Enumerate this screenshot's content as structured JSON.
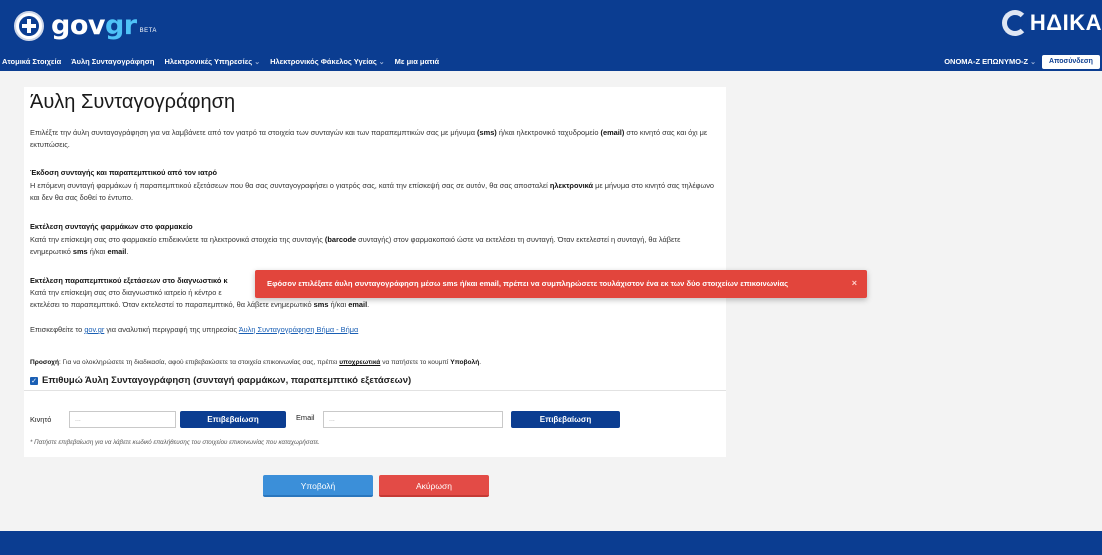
{
  "header": {
    "logo_text_gov": "gov",
    "logo_text_gr": "gr",
    "logo_badge": "BETA",
    "partner_logo": "ΗΔΙΚΑ"
  },
  "nav": {
    "items": [
      {
        "label": "Ατομικά Στοιχεία",
        "dropdown": false
      },
      {
        "label": "Άυλη Συνταγογράφηση",
        "dropdown": false
      },
      {
        "label": "Ηλεκτρονικές Υπηρεσίες",
        "dropdown": true
      },
      {
        "label": "Ηλεκτρονικός Φάκελος Υγείας",
        "dropdown": true
      },
      {
        "label": "Με μια ματιά",
        "dropdown": false
      }
    ],
    "user": "ΟΝΟΜΑ-Ζ ΕΠΩΝΥΜΟ-Ζ",
    "logout": "Αποσύνδεση"
  },
  "page": {
    "title": "Άυλη Συνταγογράφηση",
    "intro_1": "Επιλέξτε την άυλη συνταγογράφηση για να λαμβάνετε από τον γιατρό τα στοιχεία των συνταγών και των παραπεμπτικών σας με μήνυμα ",
    "intro_sms": "(sms)",
    "intro_2": " ή/και ηλεκτρονικό ταχυδρομείο ",
    "intro_email": "(email)",
    "intro_3": " στο κινητό σας και όχι με εκτυπώσεις.",
    "sec1_title": "Έκδοση συνταγής και παραπεμπτικού από τον ιατρό",
    "sec1_text_1": "Η επόμενη συνταγή φαρμάκων ή παραπεμπτικού εξετάσεων που θα σας συνταγογραφήσει ο γιατρός σας, κατά την επίσκεψή σας σε αυτόν, θα σας αποσταλεί ",
    "sec1_bold": "ηλεκτρονικά",
    "sec1_text_2": " με μήνυμα στο κινητό σας τηλέφωνο και δεν θα σας δοθεί το έντυπο.",
    "sec2_title": "Εκτέλεση συνταγής φαρμάκων στο φαρμακείο",
    "sec2_text_1": "Κατά την επίσκεψη σας στο φαρμακείο επιδεικνύετε τα ηλεκτρονικά στοιχεία της συνταγής ",
    "sec2_bold": "(barcode",
    "sec2_text_2": " συνταγής) στον φαρμακοποιό ώστε να εκτελέσει τη συνταγή. Όταν εκτελεστεί η συνταγή, θα λάβετε ενημερωτικό ",
    "sec2_sms": "sms",
    "sec2_text_3": " ή/και ",
    "sec2_email": "email",
    "sec2_text_4": ".",
    "sec3_title": "Εκτέλεση παραπεμπτικού εξετάσεων στο διαγνωστικό κ",
    "sec3_line1": "Κατά την επίσκεψη σας στο διαγνωστικό ιατρείο ή κέντρο ε",
    "sec3_line2_1": "εκτελέσει το παραπεμπτικό. Όταν εκτελεστεί το παραπεμπτικό, θα λάβετε ενημερωτικό ",
    "sec3_sms": "sms",
    "sec3_line2_2": " ή/και ",
    "sec3_email": "email",
    "sec3_line2_3": ".",
    "visit_1": "Επισκεφθείτε το ",
    "visit_link1": "gov.gr",
    "visit_2": " για αναλυτική περιγραφή της υπηρεσίας ",
    "visit_link2": "Άυλη Συνταγογράφηση Βήμα - Βήμα",
    "note_label": "Προσοχή",
    "note_1": ": Για να ολοκληρώσετε τη διαδικασία, αφού επιβεβαιώσετε τα στοιχεία επικοινωνίας σας, πρέπει ",
    "note_must": "υποχρεωτικά",
    "note_2": " να πατήσετε το κουμπί ",
    "note_submit": "Υποβολή",
    "note_3": "."
  },
  "form": {
    "checkbox_label": "Επιθυμώ Άυλη Συνταγογράφηση (συνταγή φαρμάκων, παραπεμπτικό εξετάσεων)",
    "checkbox_checked": true,
    "mobile_label": "Κινητό",
    "mobile_placeholder": "...",
    "mobile_confirm": "Επιβεβαίωση",
    "email_label": "Email",
    "email_placeholder": "...",
    "email_confirm": "Επιβεβαίωση",
    "hint": "* Πατήστε επιβεβαίωση για να λάβετε κωδικό επαλήθευσης του στοιχείου επικοινωνίας που καταχωρήσατε.",
    "submit": "Υποβολή",
    "cancel": "Ακύρωση"
  },
  "toast": {
    "message": "Εφόσον επιλέξατε άυλη συνταγογράφηση μέσω sms ή/και email, πρέπει να συμπληρώσετε τουλάχιστον ένα εκ των δύο στοιχείων επικοινωνίας",
    "close": "×"
  },
  "colors": {
    "brand_blue": "#0b3d91",
    "submit_blue": "#3b8fd9",
    "cancel_red": "#e34b46",
    "toast_red": "#e2453c"
  }
}
